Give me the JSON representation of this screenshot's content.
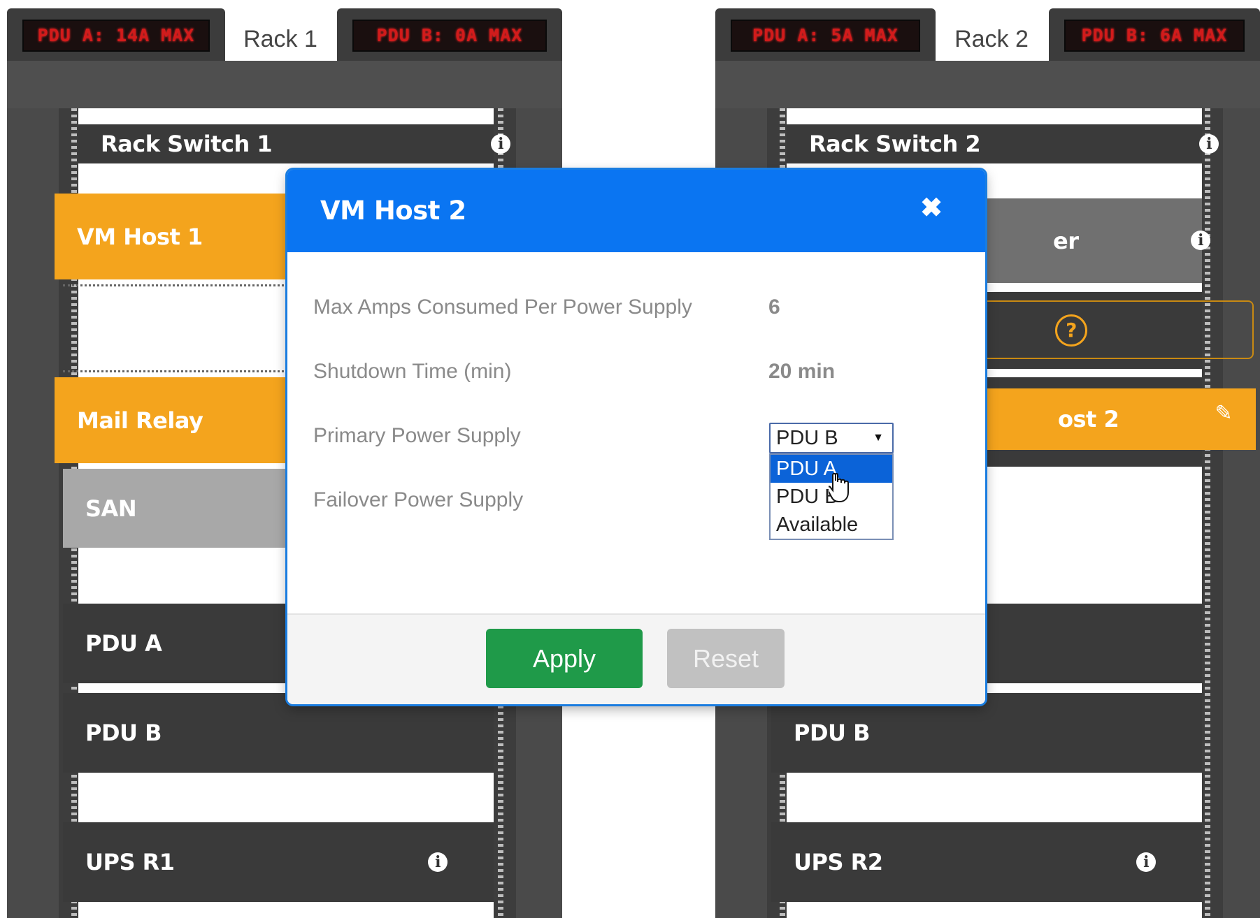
{
  "racks": [
    {
      "name": "Rack 1",
      "pdu_a_display": "PDU A: 14A MAX",
      "pdu_b_display": "PDU B: 0A MAX",
      "units": {
        "rack_switch": "Rack Switch 1",
        "vm_host": "VM Host 1",
        "mail_relay": "Mail Relay",
        "san": "SAN",
        "pdu_a": "PDU A",
        "pdu_b": "PDU B",
        "ups": "UPS R1"
      }
    },
    {
      "name": "Rack 2",
      "pdu_a_display": "PDU A: 5A MAX",
      "pdu_b_display": "PDU B: 6A MAX",
      "units": {
        "rack_switch": "Rack Switch 2",
        "partial_server": "er",
        "partial_host": "ost 2",
        "pdu_b": "PDU B",
        "ups": "UPS R2"
      }
    }
  ],
  "dialog": {
    "title": "VM Host 2",
    "fields": [
      {
        "label": "Max Amps Consumed Per Power Supply",
        "value": "6"
      },
      {
        "label": "Shutdown Time (min)",
        "value": "20 min"
      },
      {
        "label": "Primary Power Supply",
        "value": "PDU B"
      },
      {
        "label": "Failover Power Supply",
        "value": ""
      }
    ],
    "dropdown_options": [
      "PDU A",
      "PDU B",
      "Available"
    ],
    "dropdown_highlighted": "PDU A",
    "apply_label": "Apply",
    "reset_label": "Reset"
  },
  "colors": {
    "dialog_header": "#0a75f2",
    "apply": "#1f9a49",
    "reset": "#c1c1c1",
    "server_orange": "#f4a41d",
    "unit_dark": "#3a3a3a",
    "led_red": "#d21b1b"
  },
  "icons": [
    "info-icon",
    "close-icon",
    "edit-icon",
    "help-icon",
    "mouse-pointer-icon"
  ]
}
